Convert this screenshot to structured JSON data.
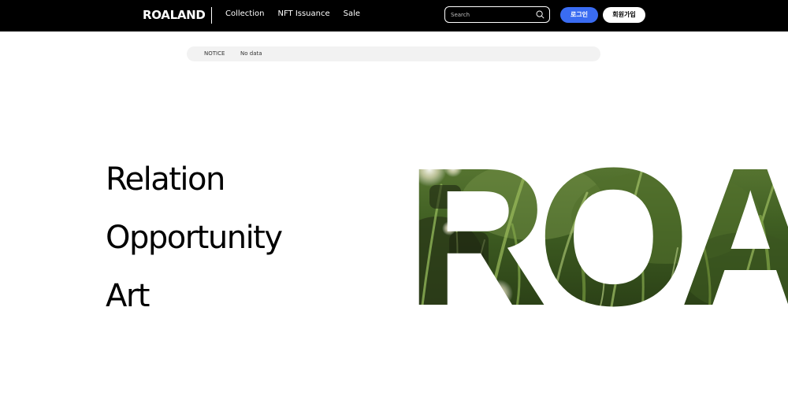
{
  "header": {
    "logo": "ROALAND",
    "nav": [
      "Collection",
      "NFT Issuance",
      "Sale"
    ],
    "search": {
      "placeholder": "Search",
      "value": ""
    },
    "login_label": "로그인",
    "signup_label": "회원가입"
  },
  "notice": {
    "label": "NOTICE",
    "separator": "|",
    "text": "No data"
  },
  "hero": {
    "lines": [
      "Relation",
      "Opportunity",
      "Art"
    ],
    "big_text": "ROA"
  },
  "colors": {
    "header_bg": "#000000",
    "accent_blue": "#3a6cf2",
    "notice_bg": "#f2f2f2",
    "grass_dark": "#2f4a1c",
    "grass_light": "#7a9a4a"
  },
  "icons": {
    "search": "search-icon"
  }
}
